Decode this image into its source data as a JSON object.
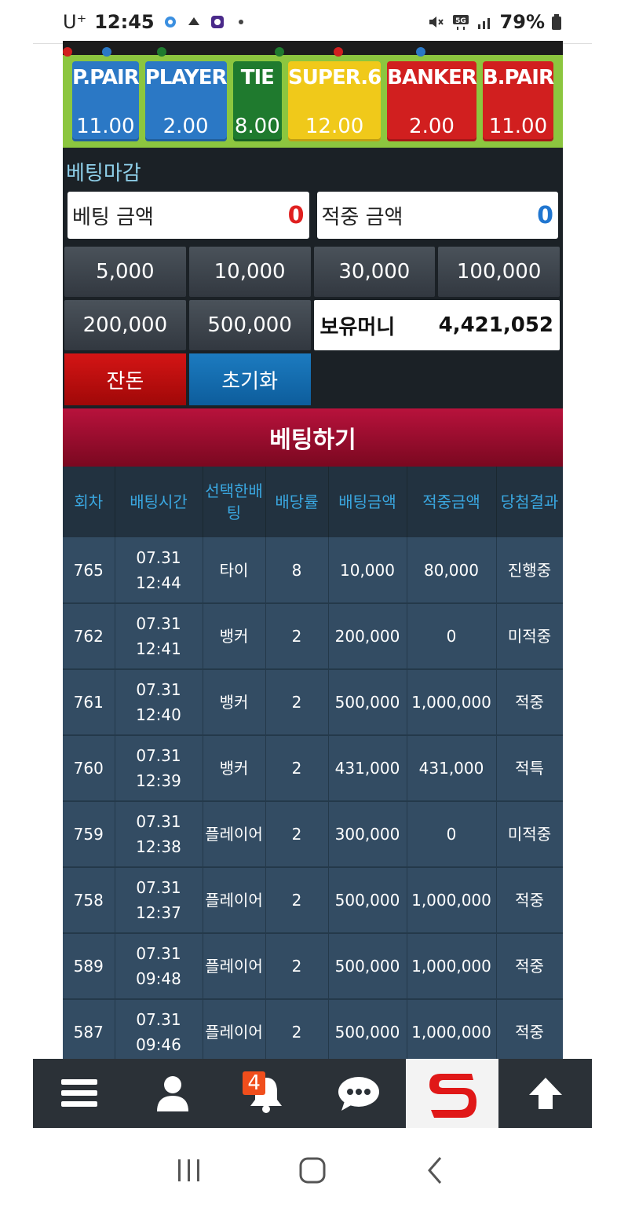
{
  "status_bar": {
    "carrier": "U⁺",
    "time": "12:45",
    "battery": "79%"
  },
  "bet_options": [
    {
      "label": "P.PAIR",
      "odds": "11.00",
      "color": "#2b78c5"
    },
    {
      "label": "PLAYER",
      "odds": "2.00",
      "color": "#2b78c5"
    },
    {
      "label": "TIE",
      "odds": "8.00",
      "color": "#1f7a2e"
    },
    {
      "label": "SUPER.6",
      "odds": "12.00",
      "color": "#f0c91a"
    },
    {
      "label": "BANKER",
      "odds": "2.00",
      "color": "#d11f1f"
    },
    {
      "label": "B.PAIR",
      "odds": "11.00",
      "color": "#d11f1f"
    }
  ],
  "closing_label": "베팅마감",
  "bet_amount": {
    "label": "베팅 금액",
    "value": "0"
  },
  "win_amount": {
    "label": "적중 금액",
    "value": "0"
  },
  "chips": [
    "5,000",
    "10,000",
    "30,000",
    "100,000",
    "200,000",
    "500,000"
  ],
  "balance": {
    "label": "보유머니",
    "value": "4,421,052"
  },
  "change_label": "잔돈",
  "reset_label": "초기화",
  "submit_label": "베팅하기",
  "history": {
    "headers": [
      "회차",
      "배팅시간",
      "선택한배팅",
      "배당률",
      "배팅금액",
      "적중금액",
      "당첨결과"
    ],
    "rows": [
      {
        "round": "765",
        "date": "07.31",
        "time": "12:44",
        "pick": "타이",
        "odds": "8",
        "bet": "10,000",
        "win": "80,000",
        "result": "진행중",
        "status": "prog"
      },
      {
        "round": "762",
        "date": "07.31",
        "time": "12:41",
        "pick": "뱅커",
        "odds": "2",
        "bet": "200,000",
        "win": "0",
        "result": "미적중",
        "status": "miss"
      },
      {
        "round": "761",
        "date": "07.31",
        "time": "12:40",
        "pick": "뱅커",
        "odds": "2",
        "bet": "500,000",
        "win": "1,000,000",
        "result": "적중",
        "status": "hit"
      },
      {
        "round": "760",
        "date": "07.31",
        "time": "12:39",
        "pick": "뱅커",
        "odds": "2",
        "bet": "431,000",
        "win": "431,000",
        "result": "적특",
        "status": "spec"
      },
      {
        "round": "759",
        "date": "07.31",
        "time": "12:38",
        "pick": "플레이어",
        "odds": "2",
        "bet": "300,000",
        "win": "0",
        "result": "미적중",
        "status": "miss"
      },
      {
        "round": "758",
        "date": "07.31",
        "time": "12:37",
        "pick": "플레이어",
        "odds": "2",
        "bet": "500,000",
        "win": "1,000,000",
        "result": "적중",
        "status": "hit"
      },
      {
        "round": "589",
        "date": "07.31",
        "time": "09:48",
        "pick": "플레이어",
        "odds": "2",
        "bet": "500,000",
        "win": "1,000,000",
        "result": "적중",
        "status": "hit"
      },
      {
        "round": "587",
        "date": "07.31",
        "time": "09:46",
        "pick": "플레이어",
        "odds": "2",
        "bet": "500,000",
        "win": "1,000,000",
        "result": "적중",
        "status": "hit"
      }
    ]
  },
  "bottom_nav": {
    "notification_count": "4",
    "items": [
      "menu-icon",
      "user-icon",
      "bell-icon",
      "chat-icon",
      "s-logo",
      "arrow-up-icon"
    ]
  },
  "accent_colors": {
    "player": "#2b78c5",
    "banker": "#d11f1f",
    "tie": "#1f7a2e",
    "super6": "#f0c91a",
    "submit": "#b8123c"
  }
}
